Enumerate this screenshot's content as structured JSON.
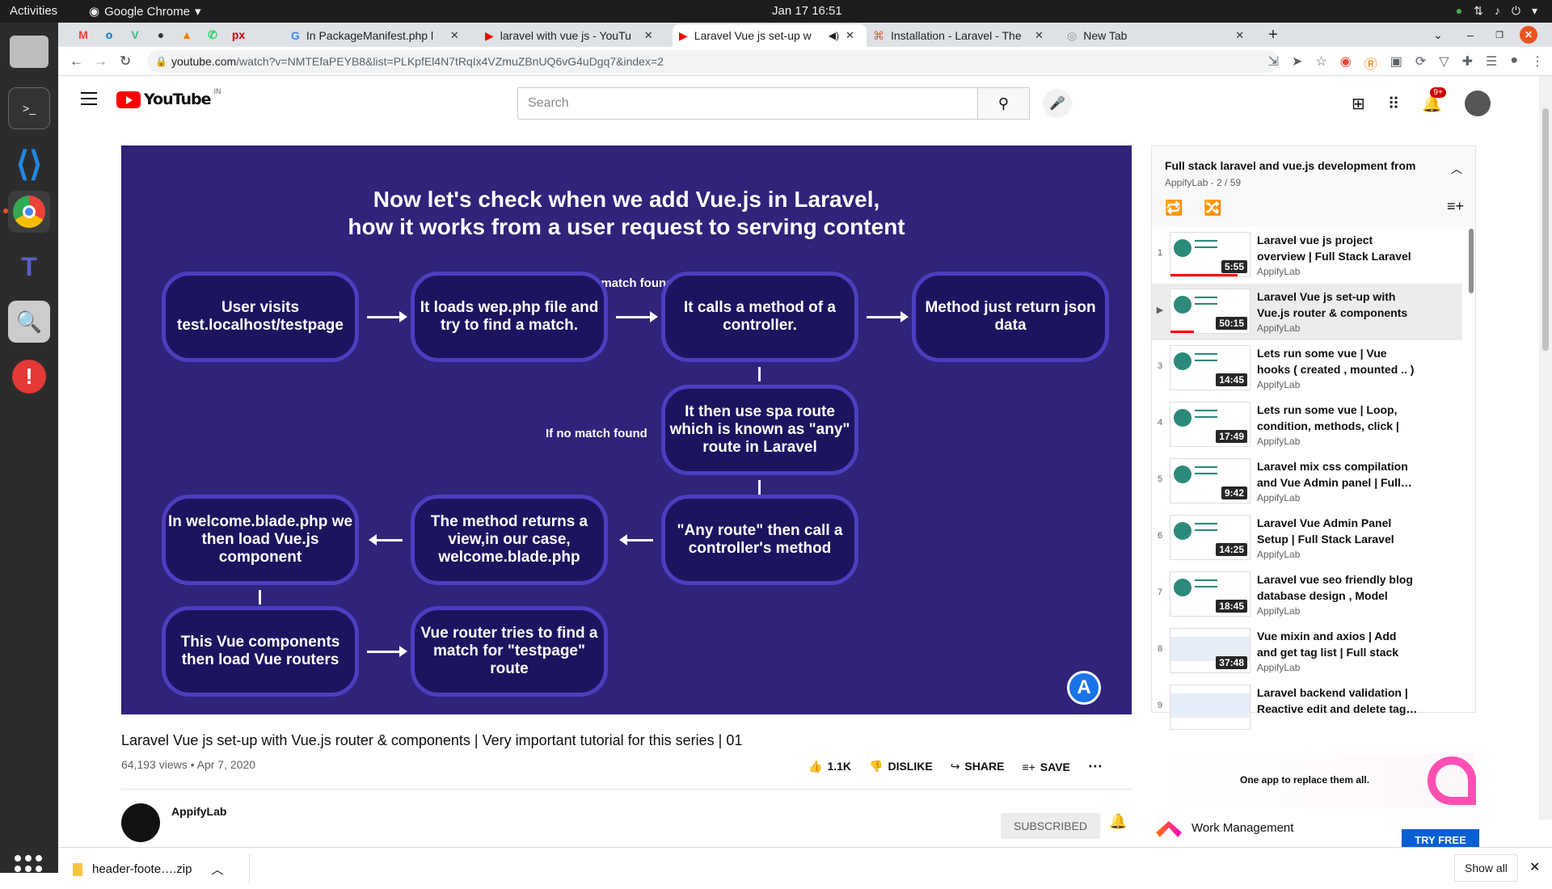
{
  "system": {
    "activities": "Activities",
    "app_name": "Google Chrome",
    "clock": "Jan 17  16:51"
  },
  "tabs": [
    {
      "title": "In PackageManifest.php l"
    },
    {
      "title": "laravel with vue js - YouTu"
    },
    {
      "title": "Laravel Vue js set-up w"
    },
    {
      "title": "Installation - Laravel - The"
    },
    {
      "title": "New Tab"
    }
  ],
  "address": {
    "host": "youtube.com",
    "path": "/watch?v=NMTEfaPEYB8&list=PLKpfEl4N7tRqIx4VZmuZBnUQ6vG4uDgq7&index=2"
  },
  "youtube": {
    "logo": "YouTube",
    "country": "IN",
    "search_placeholder": "Search",
    "notif_count": "9+"
  },
  "slide": {
    "title_line1": "Now let's check when we add Vue.js in Laravel,",
    "title_line2": "how it works from a user request to serving content",
    "if_match": "If match found",
    "if_no_match": "If no match found",
    "b1": "User visits test.localhost/testpage",
    "b2": "It loads wep.php file and try to find a match.",
    "b3": "It calls a method of a controller.",
    "b4": "Method just return json data",
    "b5": "It then use spa route which is known as \"any\" route in Laravel",
    "b6": "\"Any route\" then call a controller's method",
    "b7": "The method returns a view,in our case, welcome.blade.php",
    "b8": "In welcome.blade.php we then load Vue.js component",
    "b9": "This Vue components then load Vue routers",
    "b10": "Vue router tries to find a match for \"testpage\" route",
    "channel_mark": "A"
  },
  "video": {
    "title": "Laravel Vue js set-up with Vue.js router & components | Very important tutorial for this series | 01",
    "meta": "64,193 views • Apr 7, 2020",
    "likes": "1.1K",
    "dislike": "DISLIKE",
    "share": "SHARE",
    "save": "SAVE",
    "channel": "AppifyLab",
    "subscribe": "SUBSCRIBED"
  },
  "playlist": {
    "title": "Full stack laravel and vue.js development from",
    "sub": "AppifyLab - 2 / 59",
    "items": [
      {
        "idx": "1",
        "title": "Laravel vue js project overview | Full Stack Laravel and Vue.js…",
        "channel": "AppifyLab",
        "duration": "5:55",
        "progress": 0.85
      },
      {
        "idx": "▶",
        "title": "Laravel Vue js set-up with Vue.js router & components |…",
        "channel": "AppifyLab",
        "duration": "50:15",
        "progress": 0.3
      },
      {
        "idx": "3",
        "title": "Lets run some vue | Vue hooks ( created , mounted .. ) | Full…",
        "channel": "AppifyLab",
        "duration": "14:45",
        "progress": 0
      },
      {
        "idx": "4",
        "title": "Lets run some vue | Loop, condition, methods, click | Ful…",
        "channel": "AppifyLab",
        "duration": "17:49",
        "progress": 0
      },
      {
        "idx": "5",
        "title": "Laravel mix css compilation and Vue Admin panel | Full…",
        "channel": "AppifyLab",
        "duration": "9:42",
        "progress": 0
      },
      {
        "idx": "6",
        "title": "Laravel Vue Admin Panel Setup | Full Stack Laravel Vue…",
        "channel": "AppifyLab",
        "duration": "14:25",
        "progress": 0
      },
      {
        "idx": "7",
        "title": "Laravel vue seo friendly blog database design , Model and…",
        "channel": "AppifyLab",
        "duration": "18:45",
        "progress": 0
      },
      {
        "idx": "8",
        "title": "Vue mixin and axios | Add and get tag list | Full stack laravel…",
        "channel": "AppifyLab",
        "duration": "37:48",
        "progress": 0
      },
      {
        "idx": "9",
        "title": "Laravel backend validation | Reactive edit and delete tag…",
        "channel": "",
        "duration": "",
        "progress": 0
      }
    ]
  },
  "ad": {
    "tagline": "One app to replace them all.",
    "product": "Work Management",
    "cta": "TRY FREE"
  },
  "download": {
    "file": "header-foote….zip",
    "show_all": "Show all"
  }
}
